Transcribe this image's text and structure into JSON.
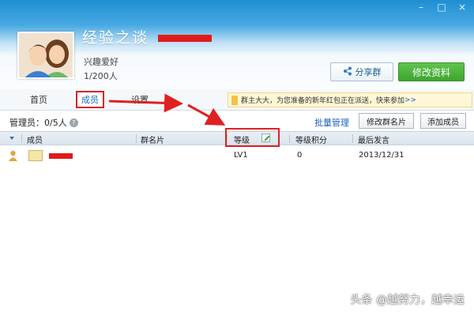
{
  "window_controls": {
    "minimize": "–",
    "maximize": "□",
    "close": "×"
  },
  "group": {
    "name": "经验之谈",
    "description": "兴趣爱好",
    "member_count": "1/200人"
  },
  "header_buttons": {
    "share": "分享群",
    "edit_profile": "修改资料"
  },
  "tabs": [
    {
      "label": "首页"
    },
    {
      "label": "成员"
    },
    {
      "label": "设置"
    }
  ],
  "notice": {
    "text": "群主大大，为您准备的新年红包正在派送，快来参加",
    "link": ">>"
  },
  "toolbar": {
    "admins": "管理员：0/5人",
    "help": "?",
    "batch_manage": "批量管理",
    "edit_card": "修改群名片",
    "add_member": "添加成员"
  },
  "table": {
    "columns": [
      "成员",
      "群名片",
      "等级",
      "等级积分",
      "最后发言"
    ],
    "rows": [
      {
        "level": "LV1",
        "points": "0",
        "last_speak": "2013/12/31"
      }
    ]
  },
  "watermark": "头条 @越努力，越幸运",
  "colors": {
    "annotation_red": "#e02020",
    "accent_green": "#3ea52f",
    "link_blue": "#1b62b8"
  }
}
